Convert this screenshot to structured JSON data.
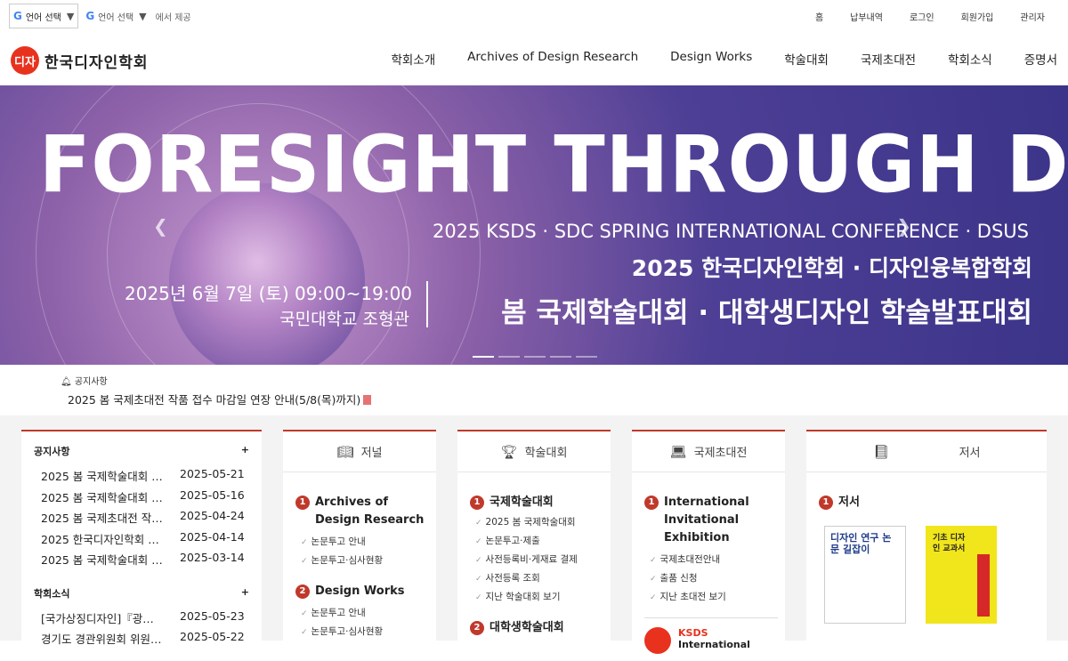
{
  "topbar": {
    "lang_select": "언어 선택",
    "lang_select2": "언어 선택",
    "provided": "에서 제공",
    "links": [
      "홈",
      "납부내역",
      "로그인",
      "회원가입",
      "관리자"
    ]
  },
  "logo": {
    "mark": "디자",
    "name": "한국디자인학회"
  },
  "menu": [
    "학회소개",
    "Archives of Design Research",
    "Design Works",
    "학술대회",
    "국제초대전",
    "학회소식",
    "증명서"
  ],
  "hero": {
    "headline": "FORESIGHT THROUGH DESIGN",
    "en_line": "2025 KSDS · SDC SPRING INTERNATIONAL CONFERENCE · DSUS",
    "ko_line1": "2025 한국디자인학회 · 디자인융복합학회",
    "date": "2025년 6월 7일 (토)  09:00~19:00",
    "place": "국민대학교 조형관",
    "ko_line2": "봄 국제학술대회 · 대학생디자인 학술발표대회"
  },
  "notice": {
    "label": "공지사항",
    "text": "2025 봄 국제초대전 작품 접수 마감일 연장 안내(5/8(목)까지)"
  },
  "news": {
    "notice_title": "공지사항",
    "notice_items": [
      {
        "title": "2025 봄 국제학술대회 …",
        "date": "2025-05-21"
      },
      {
        "title": "2025 봄 국제학술대회 …",
        "date": "2025-05-16"
      },
      {
        "title": "2025 봄 국제초대전 작…",
        "date": "2025-04-24"
      },
      {
        "title": "2025 한국디자인학회 …",
        "date": "2025-04-14"
      },
      {
        "title": "2025 봄 국제학술대회 …",
        "date": "2025-03-14"
      }
    ],
    "news_title": "학회소식",
    "news_items": [
      {
        "title": "[국가상징디자인]『광…",
        "date": "2025-05-23"
      },
      {
        "title": "경기도 경관위원회 위원…",
        "date": "2025-05-22"
      }
    ]
  },
  "journal": {
    "header": "저널",
    "s1_title": "Archives of Design Research",
    "s1_items": [
      "논문투고 안내",
      "논문투고·심사현황"
    ],
    "s2_title": "Design Works",
    "s2_items": [
      "논문투고 안내",
      "논문투고·심사현황"
    ]
  },
  "conference": {
    "header": "학술대회",
    "s1_title": "국제학술대회",
    "s1_items": [
      "2025 봄 국제학술대회",
      "논문투고·제출",
      "사전등록비·게재료 결제",
      "사전등록 조회",
      "지난 학술대회 보기"
    ],
    "s2_title": "대학생학술대회"
  },
  "exhibition": {
    "header": "국제초대전",
    "s1_title": "International Invitational Exhibition",
    "s1_items": [
      "국제초대전안내",
      "출품 신청",
      "지난 초대전 보기"
    ],
    "banner_brand": "KSDS",
    "banner_sub": "International"
  },
  "books": {
    "header": "저서",
    "s1_title": "저서",
    "book1": "디자인 연구 논문 길잡이",
    "book2": "기초 디자인 교과서"
  },
  "colors": {
    "accent": "#c0392b",
    "hero_bg": "#3b3489"
  }
}
